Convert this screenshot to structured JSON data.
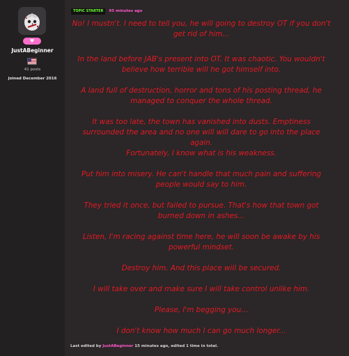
{
  "user": {
    "name": "JustABeginner",
    "posts": "41 posts",
    "joined": "Joined December 2016",
    "badge_icon": "heart-icon",
    "flag_icon": "us-flag-icon"
  },
  "post": {
    "badge": "TOPIC STARTER",
    "time": "95 minutes ago",
    "paragraphs": [
      "No! I mustn't. I need to tell you, he will going to destroy OT if you don't get rid of him...",
      "In the land before JAB's present into OT. It was chaotic. You wouldn't believe how terrible will he got himself into.",
      "A land full of destruction, horror and tons of his posting thread, he managed to conquer the whole thread.",
      "It was too late, the town has vanished into dusts. Emptiness surrounded the area and no one will will dare to go into the place again.",
      "Fortunately, I know what is his weakness.",
      "Put him into misery. He can't handle that much pain and suffering people would say to him.",
      "They tried it once, but failed to pursue. That's how that town got burned down in ashes...",
      "Listen, I'm racing against time here, he will soon be awake by his powerful mindset.",
      "Destroy him. And this place will be secured.",
      "I will take over and make sure I will take control unlike him.",
      "Please, I'm begging you...",
      "I don't know how much I can go much longer..."
    ],
    "footer_prefix": "Last edited by ",
    "footer_user": "JustABeginner",
    "footer_suffix": " 15 minutes ago, edited 1 time in total."
  },
  "colors": {
    "post_text": "#e31b23",
    "accent_pink": "#ff58c8",
    "badge_green": "#6cff2e"
  }
}
